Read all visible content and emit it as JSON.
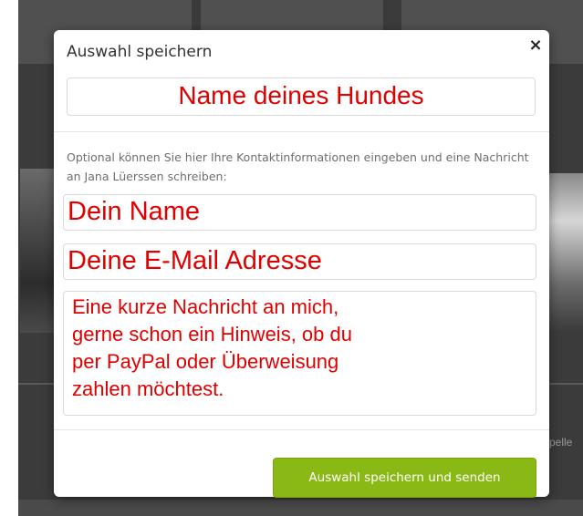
{
  "modal": {
    "title": "Auswahl speichern",
    "close_label": "×",
    "dog_name_field": "Name deines Hundes",
    "helper_text": "Optional können Sie hier Ihre Kontaktinformationen eingeben und eine Nachricht an Jana Lüerssen schreiben:",
    "name_field": "Dein Name",
    "email_field": "Deine E-Mail Adresse",
    "message_field": "Eine kurze Nachricht an mich,\ngerne schon ein Hinweis, ob du\nper PayPal oder Überweisung\nzahlen möchtest.",
    "submit_label": "Auswahl speichern und senden"
  },
  "background": {
    "partial_text": "pelle"
  },
  "colors": {
    "accent_green": "#8ab814",
    "annotation_red": "#e10000"
  }
}
